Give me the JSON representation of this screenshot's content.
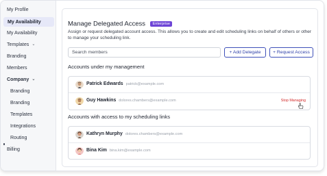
{
  "sidebar": {
    "items": [
      {
        "label": "My Profile"
      },
      {
        "label": "My Availability"
      },
      {
        "label": "My Availability"
      },
      {
        "label": "Templates"
      },
      {
        "label": "Branding"
      },
      {
        "label": "Members"
      },
      {
        "label": "Company"
      },
      {
        "label": "Branding"
      },
      {
        "label": "Branding"
      },
      {
        "label": "Templates"
      },
      {
        "label": "Integrations"
      },
      {
        "label": "Routing"
      },
      {
        "label": "Billing"
      }
    ]
  },
  "main": {
    "title": "Manage Delegated Access",
    "badge": "Enterprise",
    "description": "Assign or request delegated account access. This allows you to create and edit scheduling links on behalf of others or other to manage your scheduling link.",
    "search_placeholder": "Search members",
    "add_delegate_label": "+ Add Delegate",
    "request_access_label": "+ Request Access",
    "managed_section_title": "Accounts under my management",
    "managed": [
      {
        "name": "Patrick Edwards",
        "email": "patrick@example.com"
      },
      {
        "name": "Guy Hawkins",
        "email": "dolores.chambers@example.com",
        "action": "Stop Managing"
      }
    ],
    "access_section_title": "Accounts with access to my scheduling links",
    "access": [
      {
        "name": "Kathryn Murphy",
        "email": "dolores.chambers@example.com"
      },
      {
        "name": "Bina Kim",
        "email": "bina.kim@example.com"
      }
    ]
  },
  "colors": {
    "accent": "#2c3ea8",
    "badge": "#6d44d6",
    "danger": "#d22a2a",
    "active_bg": "#e6e8f8"
  }
}
